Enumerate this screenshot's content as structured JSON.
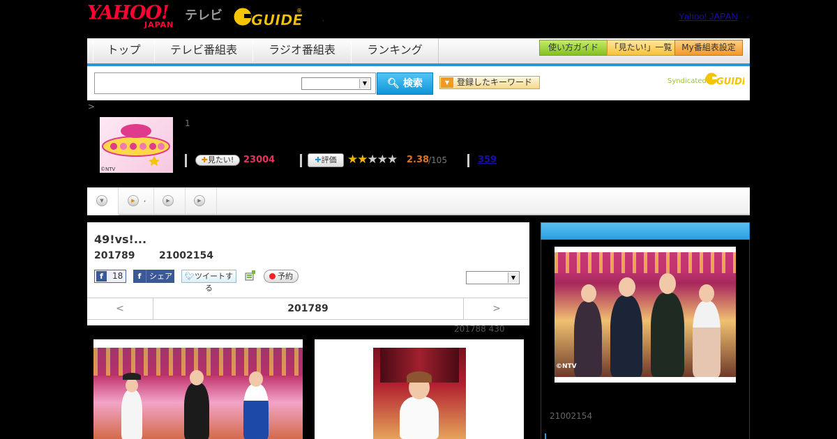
{
  "header": {
    "yahoo_logo": "YAHOO!",
    "yahoo_sub": "JAPAN",
    "tv_label": "テレビ",
    "gguide_logo": "G-GUIDE",
    "separator_dot": ",",
    "yahoo_japan_link": "Yahoo! JAPAN",
    "link_dot": ","
  },
  "nav": {
    "items": [
      {
        "label": "トップ"
      },
      {
        "label": "テレビ番組表"
      },
      {
        "label": "ラジオ番組表"
      },
      {
        "label": "ランキング"
      }
    ],
    "buttons": {
      "guide": "使い方ガイド",
      "mitai_list": "「見たい!」一覧",
      "my_settings": "My番組表設定"
    }
  },
  "search": {
    "button": "検索",
    "keyword_button": "登録したキーワード",
    "syndicated": "Syndicated",
    "syn_logo": "GUIDE"
  },
  "breadcrumb": ">",
  "program": {
    "thumb_caption": "©NTV",
    "number": "1",
    "mitai_label": "見たい!",
    "mitai_count": "23004",
    "hyoka_label": "評価",
    "stars": "★★★★★",
    "rating": "2.38",
    "rating_total": "/105",
    "review_count": "359"
  },
  "tabs": [
    {
      "label": ""
    },
    {
      "label": ","
    },
    {
      "label": ""
    },
    {
      "label": ""
    }
  ],
  "episode": {
    "title": "49!vs!...",
    "date": "201789",
    "id": "21002154",
    "fb_count": "18",
    "fb_share": "シェア",
    "tweet": "ツイートする",
    "reserve": "予約",
    "prev": "<",
    "current": "201789",
    "next": ">"
  },
  "photo_info": "201788  430",
  "sidebar": {
    "photo_caption": "©NTV",
    "id": "21002154"
  },
  "colors": {
    "accent_blue": "#2b95d6",
    "mitai_pink": "#e6325a",
    "rating_orange": "#e0731d",
    "link_blue": "#1a0dab"
  }
}
